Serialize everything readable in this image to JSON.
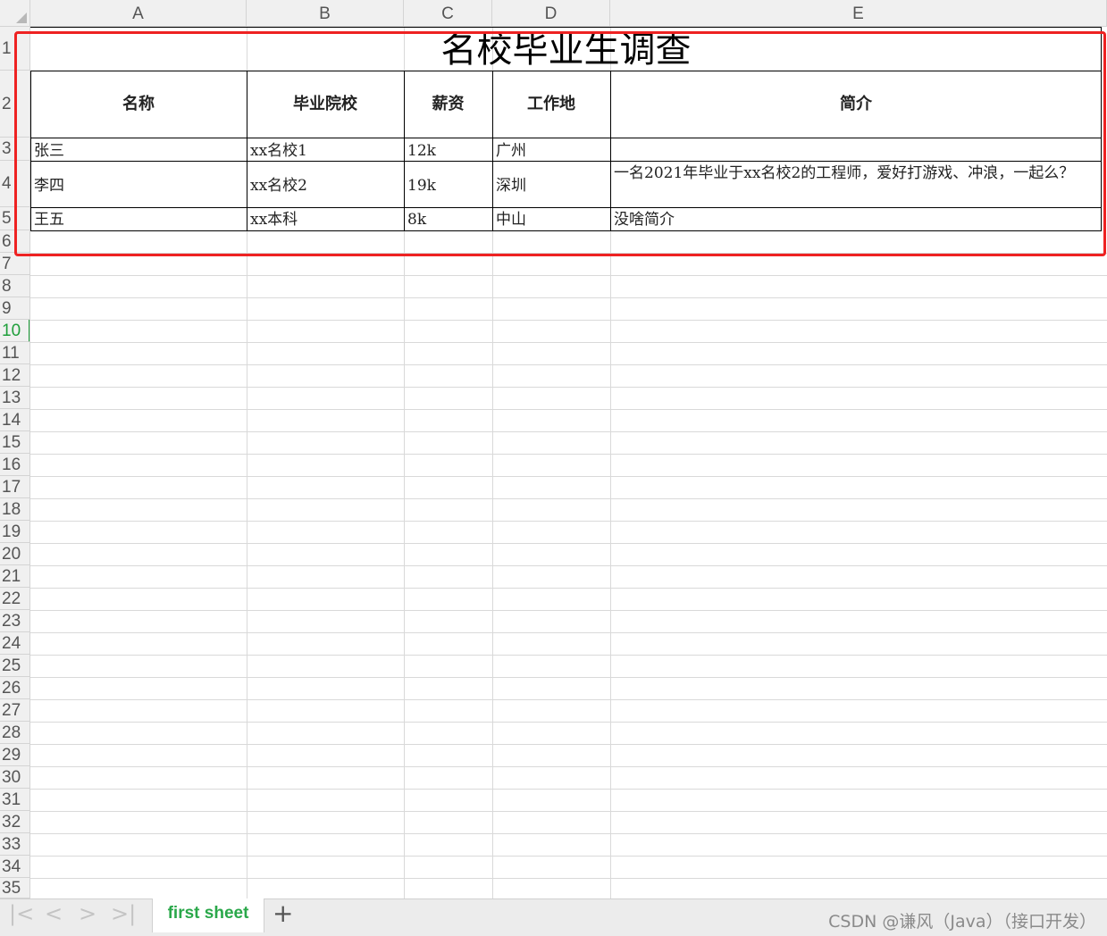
{
  "columns": [
    "A",
    "B",
    "C",
    "D",
    "E"
  ],
  "rows": [
    "1",
    "2",
    "3",
    "4",
    "5",
    "6",
    "7",
    "8",
    "9",
    "10",
    "11",
    "12",
    "13",
    "14",
    "15",
    "16",
    "17",
    "18",
    "19",
    "20",
    "21",
    "22",
    "23",
    "24",
    "25",
    "26",
    "27",
    "28",
    "29",
    "30",
    "31",
    "32",
    "33",
    "34",
    "35"
  ],
  "active_row": "10",
  "title": "名校毕业生调查",
  "headers": [
    "名称",
    "毕业院校",
    "薪资",
    "工作地",
    "简介"
  ],
  "records": [
    [
      "张三",
      "xx名校1",
      "12k",
      "广州",
      ""
    ],
    [
      "李四",
      "xx名校2",
      "19k",
      "深圳",
      "一名2021年毕业于xx名校2的工程师，爱好打游戏、冲浪，一起么？"
    ],
    [
      "王五",
      "xx本科",
      "8k",
      "中山",
      "没啥简介"
    ]
  ],
  "sheet_tab": "first sheet",
  "add_sheet": "+",
  "nav": [
    "|<",
    "<",
    ">",
    ">|"
  ],
  "watermark": "CSDN @谦风（Java）（接口开发）",
  "colors": {
    "highlight": "#ee2222",
    "active_tab": "#2aa84a"
  }
}
